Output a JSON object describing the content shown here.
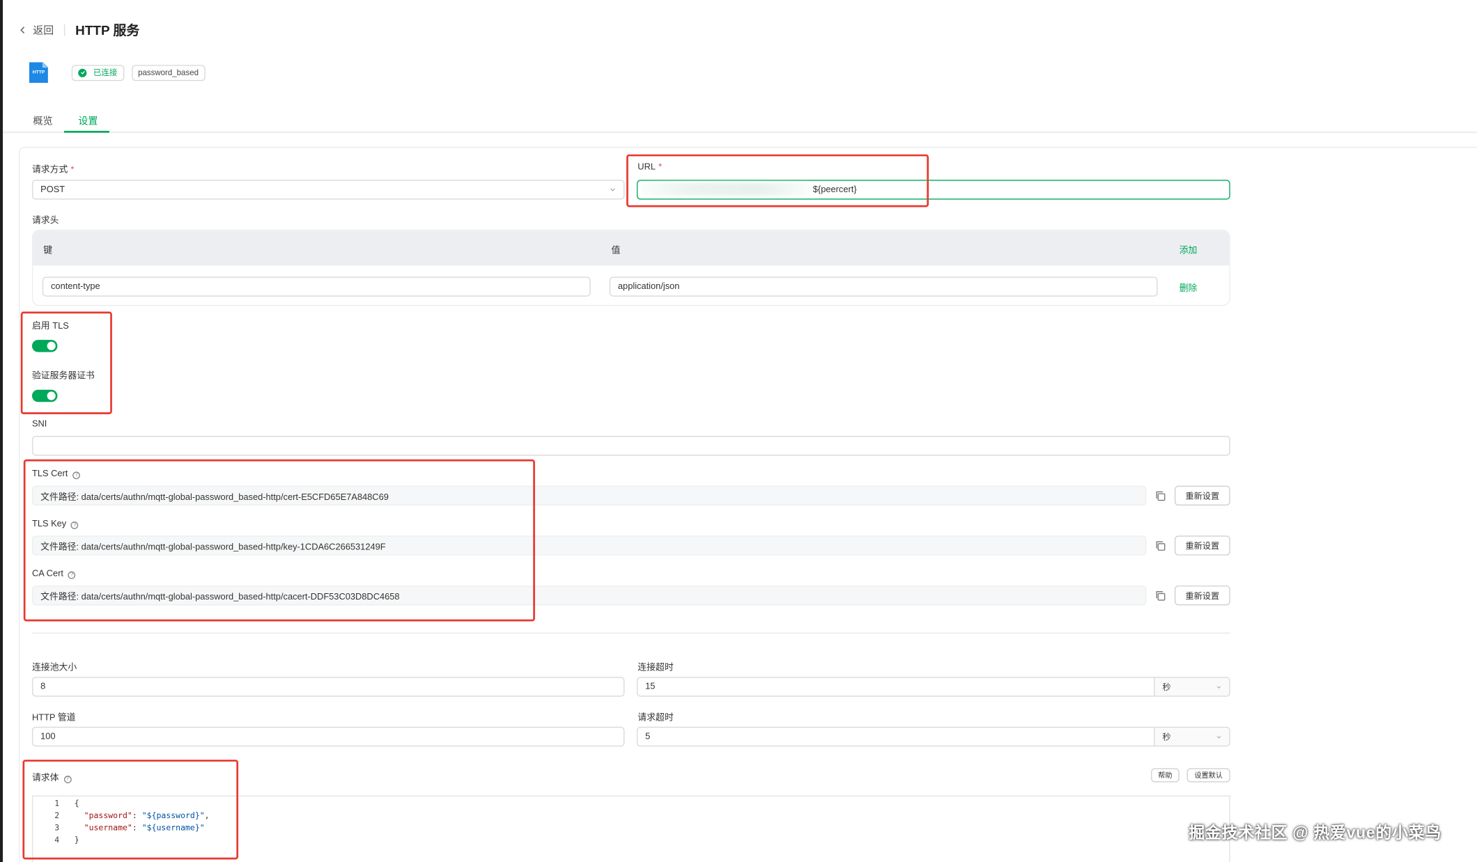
{
  "header": {
    "back_label": "返回",
    "title": "HTTP 服务"
  },
  "status": {
    "icon_text": "HTTP",
    "connected_label": "已连接",
    "mechanism": "password_based"
  },
  "tabs": [
    {
      "label": "概览"
    },
    {
      "label": "设置"
    }
  ],
  "form": {
    "method_label": "请求方式",
    "method_value": "POST",
    "url_label": "URL",
    "url_value": "${peercert}",
    "headers_label": "请求头",
    "headers_table": {
      "key_col": "键",
      "value_col": "值",
      "add_label": "添加",
      "rows": [
        {
          "key": "content-type",
          "value": "application/json",
          "delete_label": "删除"
        }
      ]
    },
    "enable_tls_label": "启用 TLS",
    "enable_tls": true,
    "verify_cert_label": "验证服务器证书",
    "verify_cert": true,
    "sni_label": "SNI",
    "sni_value": "",
    "tls_cert": {
      "label": "TLS Cert",
      "value": "文件路径: data/certs/authn/mqtt-global-password_based-http/cert-E5CFD65E7A848C69",
      "reset_label": "重新设置"
    },
    "tls_key": {
      "label": "TLS Key",
      "value": "文件路径: data/certs/authn/mqtt-global-password_based-http/key-1CDA6C266531249F",
      "reset_label": "重新设置"
    },
    "ca_cert": {
      "label": "CA Cert",
      "value": "文件路径: data/certs/authn/mqtt-global-password_based-http/cacert-DDF53C03D8DC4658",
      "reset_label": "重新设置"
    },
    "pool_size_label": "连接池大小",
    "pool_size": "8",
    "connect_timeout_label": "连接超时",
    "connect_timeout": "15",
    "connect_timeout_unit": "秒",
    "pipelining_label": "HTTP 管道",
    "pipelining": "100",
    "request_timeout_label": "请求超时",
    "request_timeout": "5",
    "request_timeout_unit": "秒",
    "body_label": "请求体",
    "help_label": "帮助",
    "set_default_label": "设置默认",
    "body_lines": [
      {
        "num": "1",
        "text": "{"
      },
      {
        "num": "2",
        "key": "\"password\"",
        "sep": ": ",
        "value": "\"${password}\"",
        "end": ","
      },
      {
        "num": "3",
        "key": "\"username\"",
        "sep": ": ",
        "value": "\"${username}\"",
        "end": ""
      },
      {
        "num": "4",
        "text": "}"
      }
    ]
  },
  "watermark": "掘金技术社区 @ 热爱vue的小菜鸟",
  "colors": {
    "accent": "#00a85a",
    "annotation": "#e8382f"
  }
}
